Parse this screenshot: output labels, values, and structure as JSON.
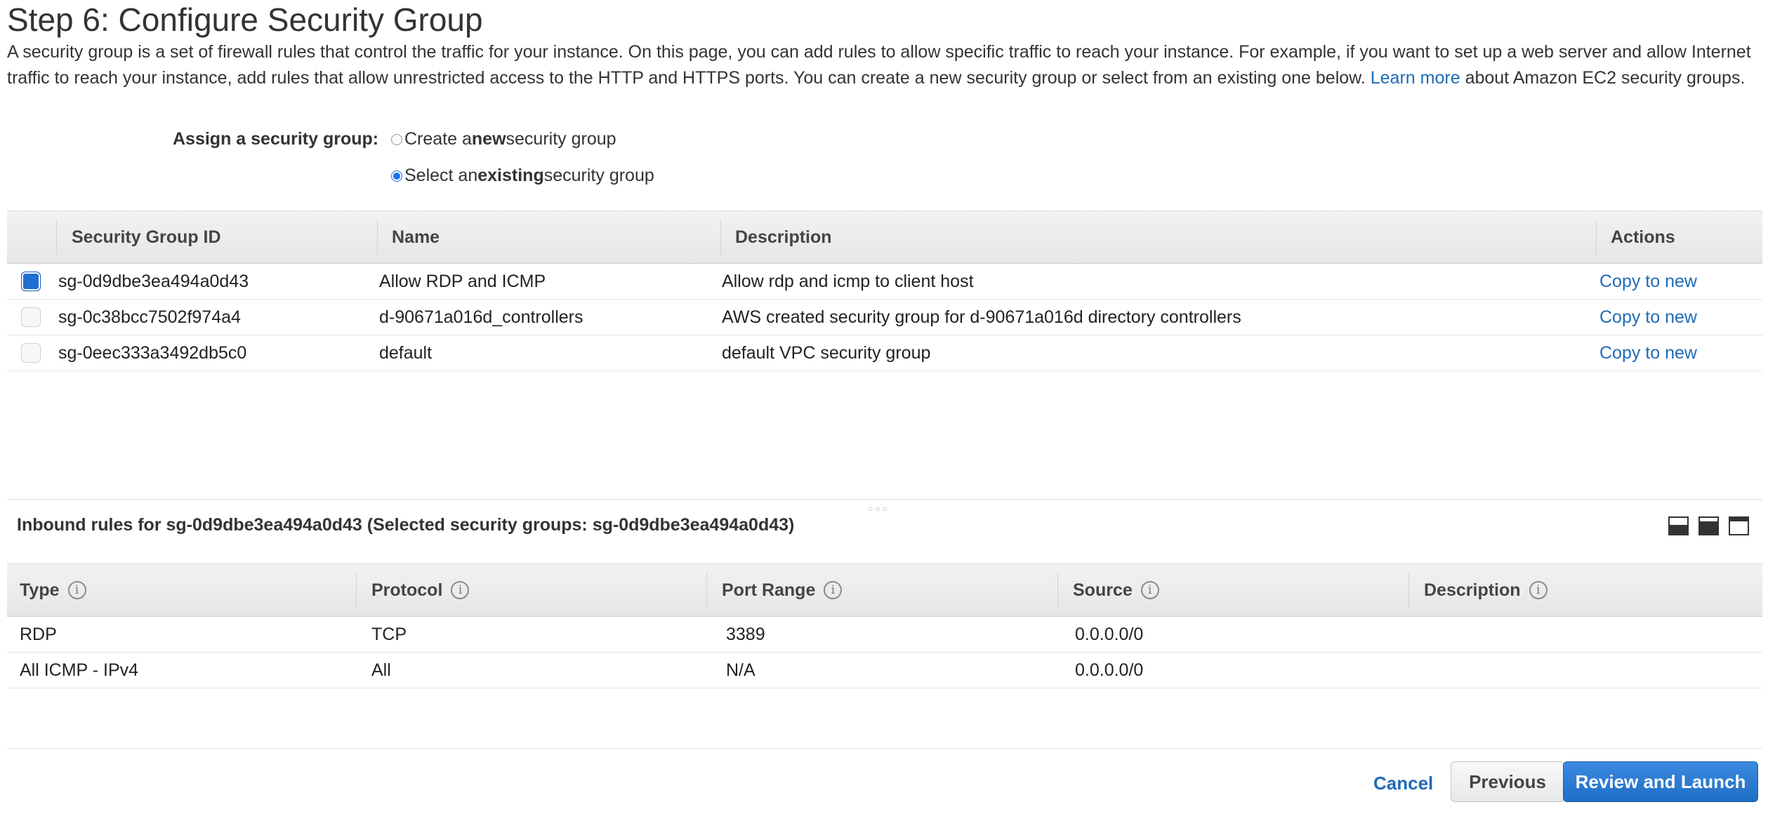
{
  "page": {
    "title": "Step 6: Configure Security Group",
    "intro_text_before_link": "A security group is a set of firewall rules that control the traffic for your instance. On this page, you can add rules to allow specific traffic to reach your instance. For example, if you want to set up a web server and allow Internet traffic to reach your instance, add rules that allow unrestricted access to the HTTP and HTTPS ports. You can create a new security group or select from an existing one below.",
    "intro_link": "Learn more",
    "intro_text_after_link": "about Amazon EC2 security groups."
  },
  "assign": {
    "label": "Assign a security group:",
    "options": [
      {
        "prefix": "Create a ",
        "bold": "new",
        "suffix": " security group",
        "selected": false
      },
      {
        "prefix": "Select an ",
        "bold": "existing",
        "suffix": " security group",
        "selected": true
      }
    ]
  },
  "security_groups": {
    "columns": [
      "Security Group ID",
      "Name",
      "Description",
      "Actions"
    ],
    "rows": [
      {
        "id": "sg-0d9dbe3ea494a0d43",
        "name": "Allow RDP and ICMP",
        "description": "Allow rdp and icmp to client host",
        "action": "Copy to new",
        "checked": true
      },
      {
        "id": "sg-0c38bcc7502f974a4",
        "name": "d-90671a016d_controllers",
        "description": "AWS created security group for d-90671a016d directory controllers",
        "action": "Copy to new",
        "checked": false
      },
      {
        "id": "sg-0eec333a3492db5c0",
        "name": "default",
        "description": "default VPC security group",
        "action": "Copy to new",
        "checked": false
      }
    ]
  },
  "inbound": {
    "title": "Inbound rules for sg-0d9dbe3ea494a0d43 (Selected security groups: sg-0d9dbe3ea494a0d43)",
    "panel_icons": [
      "panel-bottom-icon",
      "panel-middle-icon",
      "panel-top-icon"
    ],
    "columns": [
      "Type",
      "Protocol",
      "Port Range",
      "Source",
      "Description"
    ],
    "rows": [
      {
        "type": "RDP",
        "protocol": "TCP",
        "port_range": "3389",
        "source": "0.0.0.0/0",
        "description": ""
      },
      {
        "type": "All ICMP - IPv4",
        "protocol": "All",
        "port_range": "N/A",
        "source": "0.0.0.0/0",
        "description": ""
      }
    ]
  },
  "footer": {
    "cancel": "Cancel",
    "previous": "Previous",
    "review": "Review and Launch"
  },
  "colors": {
    "link": "#1f6bb6",
    "primary_button": "#1f6dc5",
    "selected": "#1a73e8"
  }
}
